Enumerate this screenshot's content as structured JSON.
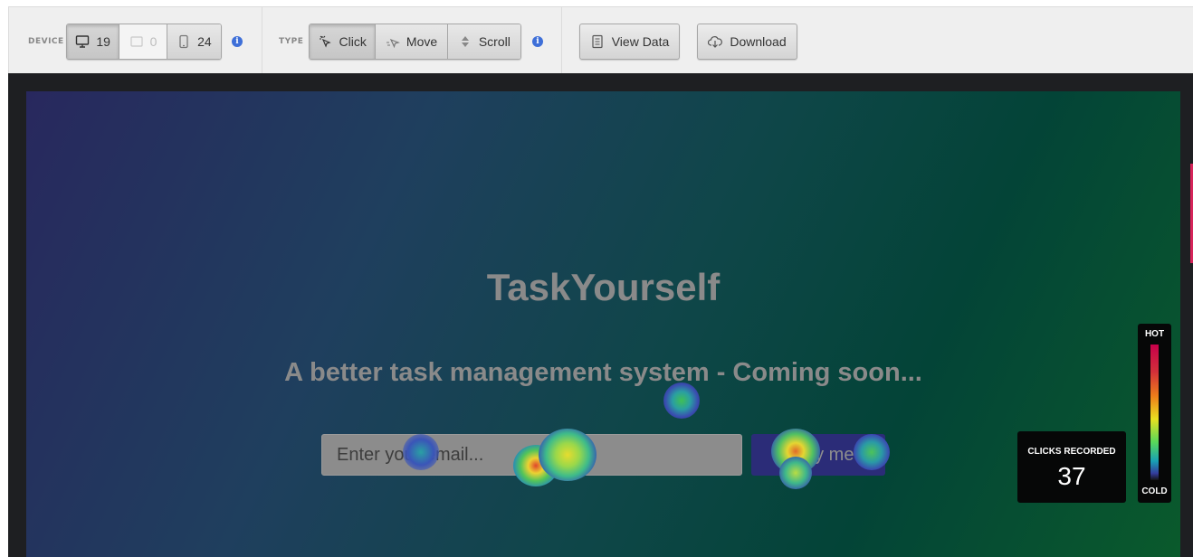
{
  "toolbar": {
    "device": {
      "label": "DEVICE",
      "desktop_count": "19",
      "tablet_count": "0",
      "mobile_count": "24"
    },
    "type": {
      "label": "TYPE",
      "click": "Click",
      "move": "Move",
      "scroll": "Scroll"
    },
    "view_data": "View Data",
    "download": "Download",
    "info_glyph": "i"
  },
  "site": {
    "title": "TaskYourself",
    "subtitle": "A better task management system - Coming soon...",
    "email_placeholder": "Enter your email...",
    "notify_button": "Notify me!"
  },
  "clicks": {
    "label": "CLICKS RECORDED",
    "value": "37"
  },
  "legend": {
    "hot": "HOT",
    "cold": "COLD"
  },
  "colors": {
    "accent_info": "#3e6fd8",
    "scroll_marker": "#d6245a",
    "notify_button": "#2b2c78"
  }
}
